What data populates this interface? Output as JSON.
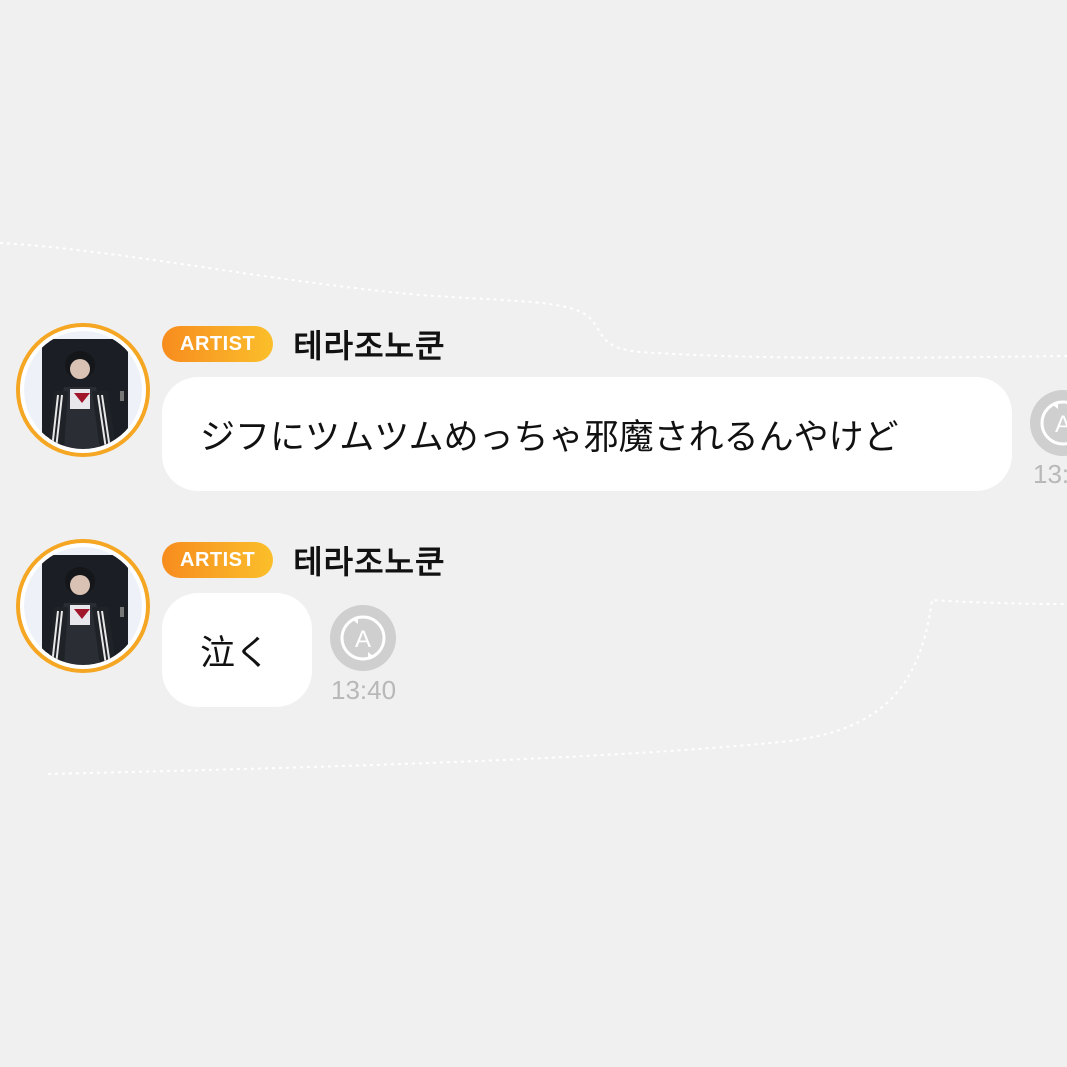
{
  "thread": {
    "messages": [
      {
        "badge": "ARTIST",
        "username": "테라조노쿤",
        "text": "ジフにツムツムめっちゃ邪魔されるんやけど",
        "time": "13:"
      },
      {
        "badge": "ARTIST",
        "username": "테라조노쿤",
        "text": "泣く",
        "time": "13:40"
      }
    ]
  },
  "colors": {
    "background": "#f0f0f0",
    "bubble": "#ffffff",
    "badge_start": "#f78c1e",
    "badge_end": "#fbbf2a",
    "avatar_ring": "#f5a623",
    "translate_button": "#cfcfcf",
    "timestamp": "#b8b8b8"
  },
  "icons": {
    "avatar": "user-avatar-photo",
    "translate": "translate-a-icon"
  }
}
